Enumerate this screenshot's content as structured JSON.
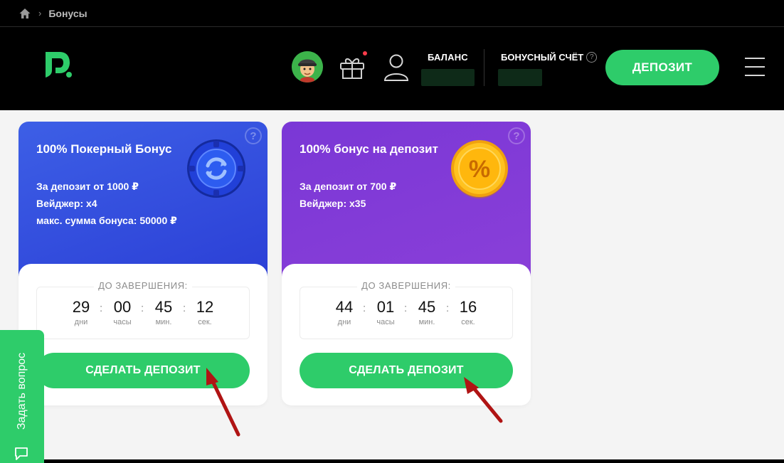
{
  "breadcrumb": {
    "current": "Бонусы"
  },
  "header": {
    "balance_label": "БАЛАНС",
    "bonus_label": "БОНУСНЫЙ СЧЁТ",
    "bonus_help": "?",
    "deposit_label": "ДЕПОЗИТ"
  },
  "cards": [
    {
      "title": "100% Покерный Бонус",
      "lines": [
        "За депозит от 1000 ₽",
        "Вейджер:  x4",
        "макс. сумма бонуса: 50000 ₽"
      ],
      "help": "?",
      "timer_label": "ДО ЗАВЕРШЕНИЯ:",
      "timer": {
        "days": "29",
        "hours": "00",
        "minutes": "45",
        "seconds": "12"
      },
      "units": {
        "days": "дни",
        "hours": "часы",
        "minutes": "мин.",
        "seconds": "сек."
      },
      "cta": "СДЕЛАТЬ ДЕПОЗИТ"
    },
    {
      "title": "100% бонус на депозит",
      "lines": [
        "За депозит от 700 ₽",
        "Вейджер:  x35"
      ],
      "help": "?",
      "timer_label": "ДО ЗАВЕРШЕНИЯ:",
      "timer": {
        "days": "44",
        "hours": "01",
        "minutes": "45",
        "seconds": "16"
      },
      "units": {
        "days": "дни",
        "hours": "часы",
        "minutes": "мин.",
        "seconds": "сек."
      },
      "coin_symbol": "%",
      "cta": "СДЕЛАТЬ ДЕПОЗИТ"
    }
  ],
  "ask_tab": {
    "label": "Задать вопрос"
  },
  "colors": {
    "accent": "#2ecc6a",
    "card_blue": "#3552e0",
    "card_purple": "#7d3ad6",
    "annotation_arrow": "#b01414"
  },
  "icons": [
    "home-icon",
    "logo-icon",
    "gift-icon",
    "user-icon",
    "menu-icon",
    "refresh-coin-icon",
    "percent-coin-icon",
    "chat-icon"
  ]
}
